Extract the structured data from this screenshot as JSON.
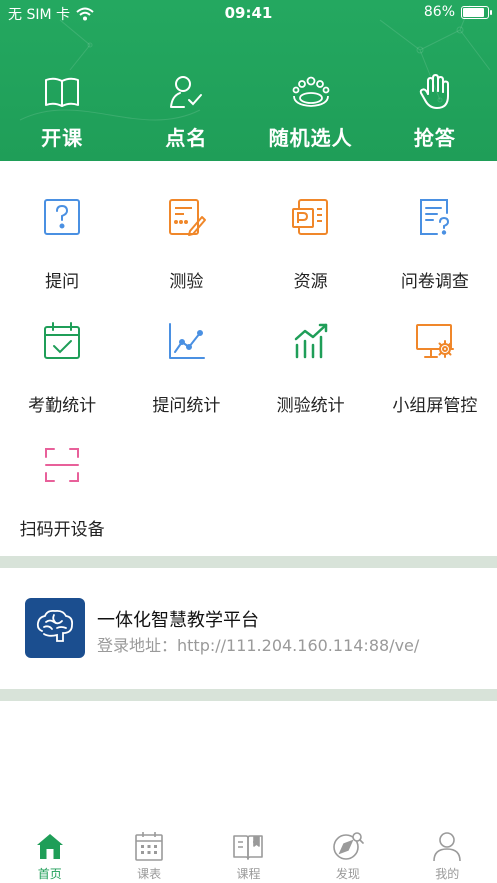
{
  "status_bar": {
    "carrier": "无 SIM 卡",
    "time": "09:41",
    "battery": "86%",
    "battery_level": 0.86
  },
  "top_actions": [
    {
      "label": "开课",
      "icon": "open-book-icon"
    },
    {
      "label": "点名",
      "icon": "roll-call-icon"
    },
    {
      "label": "随机选人",
      "icon": "group-icon"
    },
    {
      "label": "抢答",
      "icon": "hand-icon"
    }
  ],
  "grid": [
    {
      "label": "提问",
      "icon": "question-icon",
      "color": "#4a90e2"
    },
    {
      "label": "测验",
      "icon": "quiz-icon",
      "color": "#f0872a"
    },
    {
      "label": "资源",
      "icon": "resource-icon",
      "color": "#f0872a"
    },
    {
      "label": "问卷调查",
      "icon": "survey-icon",
      "color": "#4a90e2"
    },
    {
      "label": "考勤统计",
      "icon": "attendance-icon",
      "color": "#1f9e58"
    },
    {
      "label": "提问统计",
      "icon": "line-chart-icon",
      "color": "#4a90e2"
    },
    {
      "label": "测验统计",
      "icon": "bar-chart-icon",
      "color": "#1f9e58"
    },
    {
      "label": "小组屏管控",
      "icon": "screen-settings-icon",
      "color": "#f0872a"
    },
    {
      "label": "扫码开设备",
      "icon": "scan-icon",
      "color": "#e8609a"
    }
  ],
  "platform": {
    "name": "一体化智慧教学平台",
    "address": "登录地址：http://111.204.160.114:88/ve/",
    "logo_icon": "brain-icon",
    "logo_color": "#1b4e8f"
  },
  "tabs": [
    {
      "label": "首页",
      "icon": "home-icon",
      "active": true
    },
    {
      "label": "课表",
      "icon": "calendar-icon",
      "active": false
    },
    {
      "label": "课程",
      "icon": "course-book-icon",
      "active": false
    },
    {
      "label": "发现",
      "icon": "compass-icon",
      "active": false
    },
    {
      "label": "我的",
      "icon": "user-icon",
      "active": false
    }
  ],
  "colors": {
    "brand_green": "#1f9e58",
    "divider": "#d8e3d9",
    "inactive_tab": "#9a9a9a"
  }
}
